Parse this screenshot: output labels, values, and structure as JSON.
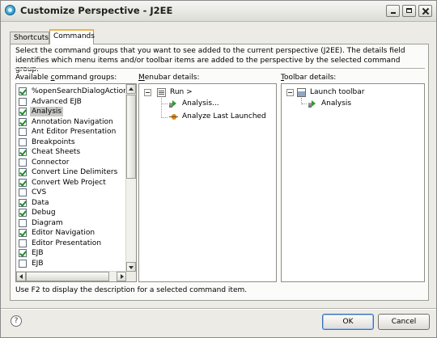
{
  "window": {
    "title": "Customize Perspective - J2EE",
    "controls": [
      "minimize",
      "maximize",
      "close"
    ]
  },
  "tabs": [
    {
      "label": "Shortcuts",
      "active": false
    },
    {
      "label": "Commands",
      "active": true
    }
  ],
  "commands": {
    "description": "Select the command groups that you want to see added to the current perspective (J2EE).  The details field identifies which menu items and/or toolbar items are added to the perspective by the selected command group.",
    "groups_header": {
      "pre": "Available ",
      "mnemonic": "c",
      "post": "ommand groups:"
    },
    "menubar_header": {
      "mnemonic": "M",
      "post": "enubar details:"
    },
    "toolbar_header": {
      "mnemonic": "T",
      "post": "oolbar details:"
    },
    "groups": [
      {
        "label": "%openSearchDialogAction.la",
        "checked": true,
        "selected": false
      },
      {
        "label": "Advanced EJB",
        "checked": false,
        "selected": false
      },
      {
        "label": "Analysis",
        "checked": true,
        "selected": true
      },
      {
        "label": "Annotation Navigation",
        "checked": true,
        "selected": false
      },
      {
        "label": "Ant Editor Presentation",
        "checked": false,
        "selected": false
      },
      {
        "label": "Breakpoints",
        "checked": false,
        "selected": false
      },
      {
        "label": "Cheat Sheets",
        "checked": true,
        "selected": false
      },
      {
        "label": "Connector",
        "checked": false,
        "selected": false
      },
      {
        "label": "Convert Line Delimiters",
        "checked": true,
        "selected": false
      },
      {
        "label": "Convert Web Project",
        "checked": true,
        "selected": false
      },
      {
        "label": "CVS",
        "checked": false,
        "selected": false
      },
      {
        "label": "Data",
        "checked": true,
        "selected": false
      },
      {
        "label": "Debug",
        "checked": true,
        "selected": false
      },
      {
        "label": "Diagram",
        "checked": false,
        "selected": false
      },
      {
        "label": "Editor Navigation",
        "checked": true,
        "selected": false
      },
      {
        "label": "Editor Presentation",
        "checked": false,
        "selected": false
      },
      {
        "label": "EJB",
        "checked": true,
        "selected": false
      },
      {
        "label": "EJB",
        "checked": false,
        "selected": false
      }
    ],
    "menubar_tree": {
      "root": {
        "label": "Run  >",
        "icon": "menu-icon",
        "expanded": true
      },
      "children": [
        {
          "label": "Analysis...",
          "icon": "run-analysis-icon"
        },
        {
          "label": "Analyze Last Launched",
          "icon": "bug-analysis-icon"
        }
      ]
    },
    "toolbar_tree": {
      "root": {
        "label": "Launch toolbar",
        "icon": "toolbar-icon",
        "expanded": true
      },
      "children": [
        {
          "label": "Analysis",
          "icon": "run-analysis-icon"
        }
      ]
    },
    "hint": "Use F2 to display the description for a selected command item."
  },
  "footer": {
    "help_icon": "?",
    "ok_label": "OK",
    "cancel_label": "Cancel"
  }
}
